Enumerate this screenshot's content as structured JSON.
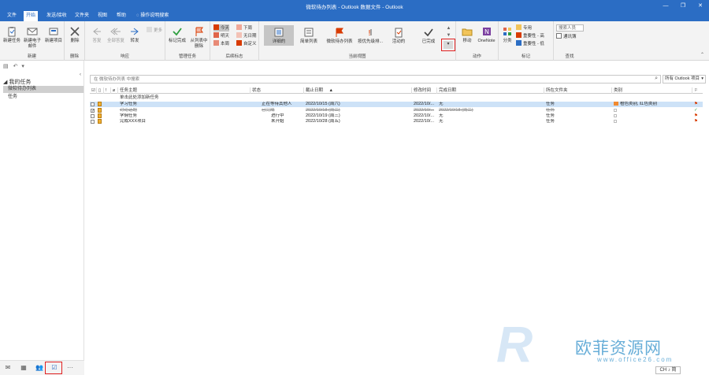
{
  "window": {
    "title": "微软待办列表 - Outlook 数据文件 - Outlook",
    "minimize": "—",
    "restore": "❐",
    "close": "✕"
  },
  "tabs": [
    {
      "label": "文件"
    },
    {
      "label": "开始"
    },
    {
      "label": "发送/接收"
    },
    {
      "label": "文件夹"
    },
    {
      "label": "视图"
    },
    {
      "label": "帮助"
    }
  ],
  "tell_me": {
    "icon": "lightbulb-icon",
    "label": "操作说明搜索"
  },
  "ribbon": {
    "new_group": {
      "label": "新建",
      "new_task": "新建任务",
      "new_email": "新建电子邮件",
      "new_item": "新建项目"
    },
    "delete_group": {
      "label": "删除",
      "delete": "删除"
    },
    "respond_group": {
      "label": "响应",
      "reply": "答复",
      "reply_all": "全部答复",
      "forward": "转发",
      "more": "更多"
    },
    "manage_group": {
      "label": "管理任务",
      "mark_complete": "标记完成",
      "remove_from_list": "从列表中删除"
    },
    "followup_group": {
      "label": "后续标志",
      "today": "今天",
      "tomorrow": "明天",
      "this_week": "本周",
      "next_week": "下周",
      "no_date": "无日期",
      "custom": "自定义"
    },
    "views_group": {
      "label": "当前视图",
      "views": [
        "详细的",
        "简单列表",
        "微软待办列表",
        "按优先级排...",
        "活动的",
        "已完成"
      ]
    },
    "actions_group": {
      "label": "动作",
      "move": "移动",
      "onenote": "OneNote"
    },
    "tags_group": {
      "label": "标记",
      "categorize": "分类",
      "private": "专用",
      "high": "重要性 - 高",
      "low": "重要性 - 低"
    },
    "find_group": {
      "label": "查找",
      "search_people": "搜索人员",
      "address_book": "通讯簿"
    }
  },
  "nav": {
    "header": "我的任务",
    "items": [
      {
        "label": "微软待办列表",
        "selected": true
      },
      {
        "label": "任务",
        "selected": false
      }
    ]
  },
  "search": {
    "placeholder": "在 微软待办列表 中搜索",
    "scope": "所有 Outlook 项目"
  },
  "columns": [
    "任务主题",
    "状态",
    "截止日期",
    "修改时间",
    "完成日期",
    "所在文件夹",
    "类别"
  ],
  "add_row": "单击此处添加新任务",
  "tasks": [
    {
      "subject": "学习任务",
      "status": "正在等待其他人",
      "due": "2022/10/15 (周六)",
      "modified": "2022/10/...",
      "completed": "无",
      "folder": "任务",
      "category": "橙色类别, 红色类别",
      "done": false,
      "highlight": true
    },
    {
      "subject": "讨论话题",
      "status": "已完成",
      "due": "2022/10/18 (周二)",
      "modified": "2022/10/...",
      "completed": "2022/10/18 (周二)",
      "folder": "任务",
      "category": "",
      "done": true,
      "highlight": false
    },
    {
      "subject": "学佣任务",
      "status": "进行中",
      "due": "2022/10/19 (周三)",
      "modified": "2022/10/...",
      "completed": "无",
      "folder": "任务",
      "category": "",
      "done": false,
      "highlight": false
    },
    {
      "subject": "完成XXX项目",
      "status": "未开始",
      "due": "2022/10/28 (周五)",
      "modified": "2022/10/...",
      "completed": "无",
      "folder": "任务",
      "category": "",
      "done": false,
      "highlight": false
    }
  ],
  "watermark": {
    "brand": "欧菲资源网",
    "url": "www.office26.com",
    "logo": "R"
  },
  "ime": "CH ♪ 简",
  "colors": {
    "accent": "#2b6dc4",
    "highlight_row": "#cde2f7",
    "red_box": "#e02020",
    "flag_red": "#d83b01",
    "check_green": "#2e9e3e"
  }
}
